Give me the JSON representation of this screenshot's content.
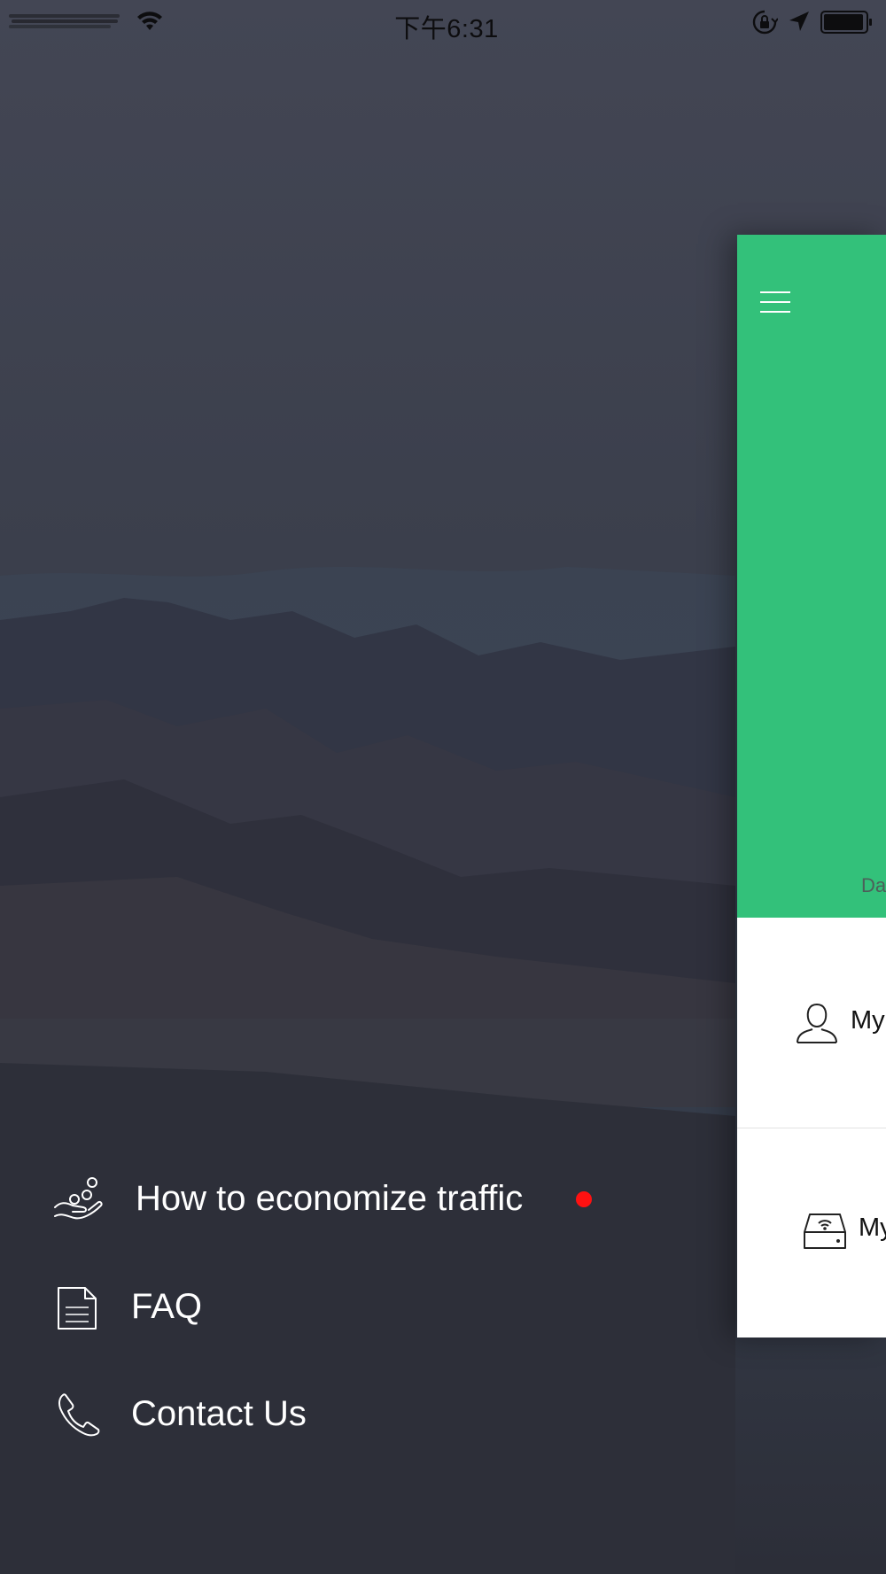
{
  "status_bar": {
    "time": "下午6:31",
    "icons": [
      "wifi-icon",
      "rotation-lock-icon",
      "location-icon",
      "battery-icon"
    ]
  },
  "side_menu": {
    "items": [
      {
        "label": "How to economize traffic",
        "icon": "hand-coins-icon",
        "has_unread_dot": true
      },
      {
        "label": "FAQ",
        "icon": "document-icon"
      },
      {
        "label": "Contact Us",
        "icon": "phone-icon"
      }
    ]
  },
  "main_panel": {
    "header_caption": "Da",
    "rows": [
      {
        "label": "My",
        "icon": "user-icon"
      },
      {
        "label": "My",
        "icon": "router-icon"
      }
    ]
  },
  "colors": {
    "header_green": "#33c17a",
    "unread_dot": "#ff1111",
    "menu_text": "#ffffff",
    "background_dark": "#3a3d4b"
  }
}
